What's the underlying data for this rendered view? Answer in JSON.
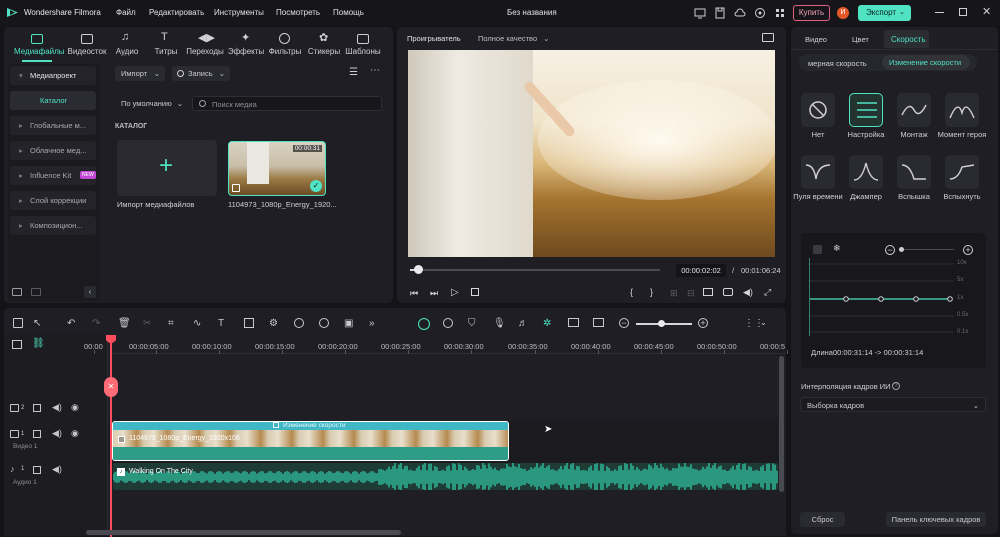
{
  "app": {
    "name": "Wondershare Filmora",
    "doc_title": "Без названия"
  },
  "menu": [
    "Файл",
    "Редактировать",
    "Инструменты",
    "Посмотреть",
    "Помощь"
  ],
  "header_buttons": {
    "buy": "Купить",
    "avatar": "И",
    "export": "Экспорт"
  },
  "media_tabs": [
    {
      "label": "Медиафайлы",
      "icon": "media-icon"
    },
    {
      "label": "Видеосток",
      "icon": "stock-video-icon"
    },
    {
      "label": "Аудио",
      "icon": "audio-note-icon"
    },
    {
      "label": "Титры",
      "icon": "title-icon"
    },
    {
      "label": "Переходы",
      "icon": "transition-icon"
    },
    {
      "label": "Эффекты",
      "icon": "effects-icon"
    },
    {
      "label": "Фильтры",
      "icon": "filters-icon"
    },
    {
      "label": "Стикеры",
      "icon": "stickers-icon"
    },
    {
      "label": "Шаблоны",
      "icon": "templates-icon"
    }
  ],
  "sidebar": {
    "project": "Медиапроект",
    "catalog": "Каталог",
    "items": [
      "Глобальные м...",
      "Облачное мед...",
      "Influence Kit",
      "Слой коррекции",
      "Композицион..."
    ],
    "new_badge": "NEW"
  },
  "media": {
    "import_label": "Импорт",
    "record_label": "Запись",
    "sort_label": "По умолчанию",
    "search_placeholder": "Поиск медиа",
    "section_title": "КАТАЛОГ",
    "import_tile": "Импорт медиафайлов",
    "clip_name": "1104973_1080p_Energy_1920...",
    "clip_duration": "00:00:31"
  },
  "player": {
    "tab": "Проигрыватель",
    "quality": "Полное качество",
    "current_time": "00:00:02:02",
    "separator": "/",
    "total_time": "00:01:06:24",
    "progress": 0.03
  },
  "inspector": {
    "tabs": [
      "Видео",
      "Цвет",
      "Скорость"
    ],
    "active_tab": "Скорость",
    "speed_modes": [
      "мерная скорость",
      "Изменение скорости"
    ],
    "presets": [
      "Нет",
      "Настройка",
      "Монтаж",
      "Момент героя",
      "Пуля времени",
      "Джампер",
      "Вспышка",
      "Вспыхнуть"
    ],
    "curve_labels": [
      "10x",
      "5x",
      "1x",
      "0.5x",
      "0.1x"
    ],
    "duration_text": "Длина00:00:31:14 -> 00:00:31:14",
    "ai_interp_label": "Интерполяция кадров ИИ",
    "ai_interp_value": "Выборка кадров",
    "reset_label": "Сброс",
    "keyframe_label": "Панель ключевых кадров"
  },
  "timeline": {
    "ruler": [
      "00:00",
      "00:00:05:00",
      "00:00:10:00",
      "00:00:15:00",
      "00:00:20:00",
      "00:00:25:00",
      "00:00:30:00",
      "00:00:35:00",
      "00:00:40:00",
      "00:00:45:00",
      "00:00:50:00",
      "00:00:5"
    ],
    "tracks": [
      {
        "num": "2",
        "label": ""
      },
      {
        "num": "1",
        "label": "Видео 1"
      },
      {
        "num": "1",
        "label": "Аудио 1"
      }
    ],
    "video_clip_title": "1104973_1080p_Energy_1920x108",
    "speed_badge": "Изменение скорости",
    "audio_clip_title": "Walking On The City"
  },
  "colors": {
    "accent": "#4fe3c4",
    "playhead": "#ff4d5e",
    "audio": "#27b898",
    "clip_border": "#ffffff"
  }
}
